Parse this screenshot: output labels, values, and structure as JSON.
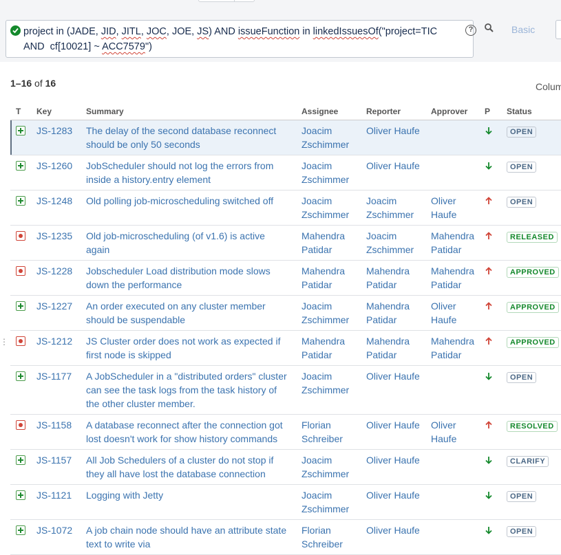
{
  "colors": {
    "link": "#3b73af",
    "open_status": "#4a6785",
    "green_status": "#14892c",
    "priority_low": "#14892c",
    "priority_high": "#d04437"
  },
  "search": {
    "jql_parts": [
      {
        "t": "project in (JADE, "
      },
      {
        "t": "JID",
        "sq": true
      },
      {
        "t": ", "
      },
      {
        "t": "JITL",
        "sq": true
      },
      {
        "t": ", "
      },
      {
        "t": "JOC",
        "sq": true
      },
      {
        "t": ", JOE, "
      },
      {
        "t": "JS",
        "sq": true
      },
      {
        "t": ") AND "
      },
      {
        "t": "issueFunction",
        "sq": true
      },
      {
        "t": " in "
      },
      {
        "t": "linkedIssuesOf",
        "sq": true
      },
      {
        "t": "(\"project=TIC\nAND  cf[10021] ~ "
      },
      {
        "t": "ACC7579",
        "sq": true
      },
      {
        "t": "\")"
      }
    ],
    "help_icon": "?",
    "basic_label": "Basic"
  },
  "results": {
    "range": "1–16",
    "of": "of",
    "total": "16"
  },
  "columns_label": "Colum",
  "table": {
    "headers": [
      "T",
      "Key",
      "Summary",
      "Assignee",
      "Reporter",
      "Approver",
      "P",
      "Status"
    ],
    "rows": [
      {
        "type": "new-feature",
        "key": "JS-1283",
        "summary": "The delay of the second database reconnect should be only 50 seconds",
        "assignee": "Joacim Zschimmer",
        "reporter": "Oliver Haufe",
        "approver": "",
        "priority": "low",
        "status": "OPEN",
        "selected": true
      },
      {
        "type": "new-feature",
        "key": "JS-1260",
        "summary": "JobScheduler should not log the errors from inside a history.entry element",
        "assignee": "Joacim Zschimmer",
        "reporter": "Oliver Haufe",
        "approver": "",
        "priority": "low",
        "status": "OPEN"
      },
      {
        "type": "new-feature",
        "key": "JS-1248",
        "summary": "Old polling job-microscheduling switched off",
        "assignee": "Joacim Zschimmer",
        "reporter": "Joacim Zschimmer",
        "approver": "Oliver Haufe",
        "priority": "high",
        "status": "OPEN"
      },
      {
        "type": "bug",
        "key": "JS-1235",
        "summary": "Old job-microscheduling (of v1.6) is active again",
        "assignee": "Mahendra Patidar",
        "reporter": "Joacim Zschimmer",
        "approver": "Mahendra Patidar",
        "priority": "high",
        "status": "RELEASED"
      },
      {
        "type": "bug",
        "key": "JS-1228",
        "summary": "Jobscheduler Load distribution mode slows down the performance",
        "assignee": "Mahendra Patidar",
        "reporter": "Mahendra Patidar",
        "approver": "Mahendra Patidar",
        "priority": "high",
        "status": "APPROVED"
      },
      {
        "type": "new-feature",
        "key": "JS-1227",
        "summary": "An order executed on any cluster member should be suspendable",
        "assignee": "Joacim Zschimmer",
        "reporter": "Mahendra Patidar",
        "approver": "Oliver Haufe",
        "priority": "high",
        "status": "APPROVED"
      },
      {
        "type": "bug",
        "key": "JS-1212",
        "summary": "JS Cluster order does not work as expected if first node is skipped",
        "assignee": "Mahendra Patidar",
        "reporter": "Mahendra Patidar",
        "approver": "Mahendra Patidar",
        "priority": "high",
        "status": "APPROVED"
      },
      {
        "type": "new-feature",
        "key": "JS-1177",
        "summary": "A JobScheduler in a \"distributed orders\" cluster can see the task logs from the task history of the other cluster member.",
        "assignee": "Joacim Zschimmer",
        "reporter": "Oliver Haufe",
        "approver": "",
        "priority": "low",
        "status": "OPEN"
      },
      {
        "type": "bug",
        "key": "JS-1158",
        "summary": "A database reconnect after the connection got lost doesn't work for show history commands",
        "assignee": "Florian Schreiber",
        "reporter": "Oliver Haufe",
        "approver": "Oliver Haufe",
        "priority": "high",
        "status": "RESOLVED"
      },
      {
        "type": "new-feature",
        "key": "JS-1157",
        "summary": "All Job Schedulers of a cluster do not stop if they all have lost the database connection",
        "assignee": "Joacim Zschimmer",
        "reporter": "Oliver Haufe",
        "approver": "",
        "priority": "low",
        "status": "CLARIFY"
      },
      {
        "type": "new-feature",
        "key": "JS-1121",
        "summary": "Logging with Jetty",
        "assignee": "Joacim Zschimmer",
        "reporter": "Oliver Haufe",
        "approver": "",
        "priority": "low",
        "status": "OPEN"
      },
      {
        "type": "new-feature",
        "key": "JS-1072",
        "summary": "A job chain node should have an attribute state  text to write via",
        "assignee": "Florian Schreiber",
        "reporter": "Oliver Haufe",
        "approver": "",
        "priority": "low",
        "status": "OPEN"
      }
    ]
  }
}
